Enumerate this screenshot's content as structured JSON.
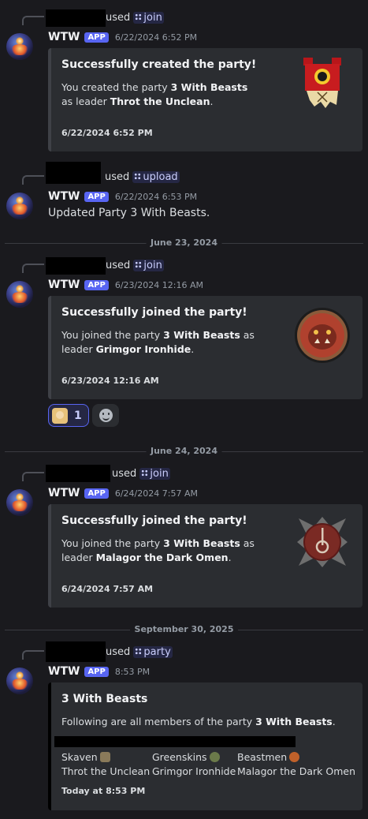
{
  "bot": {
    "name": "WTW",
    "badge": "APP"
  },
  "colors": {
    "accent": "#5865f2",
    "background": "#1a1a1e",
    "embed_bg": "#2b2d31"
  },
  "messages": [
    {
      "used_label": "used",
      "command": "join",
      "timestamp": "6/22/2024 6:52 PM",
      "embed": {
        "title": "Successfully created the party!",
        "desc_prefix": "You created the party ",
        "party": "3 With Beasts",
        "desc_mid": " as leader ",
        "leader": "Throt the Unclean",
        "desc_suffix": ".",
        "footer": "6/22/2024 6:52 PM",
        "thumbnail": "skaven-banner-icon"
      }
    },
    {
      "used_label": "used",
      "command": "upload",
      "timestamp": "6/22/2024 6:53 PM",
      "text": "Updated Party 3 With Beasts."
    },
    {
      "used_label": "used",
      "command": "join",
      "timestamp": "6/23/2024 12:16 AM",
      "embed": {
        "title": "Successfully joined the party!",
        "desc_prefix": "You joined the party ",
        "party": "3 With Beasts",
        "desc_mid": " as leader ",
        "leader": "Grimgor Ironhide",
        "desc_suffix": ".",
        "footer": "6/23/2024 12:16 AM",
        "thumbnail": "greenskin-portrait-icon"
      },
      "reactions": [
        {
          "emoji": "character-emoji",
          "count": "1"
        }
      ]
    },
    {
      "used_label": "used",
      "command": "join",
      "timestamp": "6/24/2024 7:57 AM",
      "embed": {
        "title": "Successfully joined the party!",
        "desc_prefix": "You joined the party ",
        "party": "3 With Beasts",
        "desc_mid": " as leader ",
        "leader": "Malagor the Dark Omen",
        "desc_suffix": ".",
        "footer": "6/24/2024 7:57 AM",
        "thumbnail": "beastmen-emblem-icon"
      }
    },
    {
      "used_label": "used",
      "command": "party",
      "timestamp": "8:53 PM",
      "embed": {
        "title": "3 With Beasts",
        "desc_prefix": "Following are all members of the party ",
        "party": "3 With Beasts",
        "desc_suffix": ".",
        "members": [
          {
            "faction": "Skaven",
            "leader": "Throt the Unclean",
            "icon": "skaven-faction-icon"
          },
          {
            "faction": "Greenskins",
            "leader": "Grimgor Ironhide",
            "icon": "greenskins-faction-icon"
          },
          {
            "faction": "Beastmen",
            "leader": "Malagor the Dark Omen",
            "icon": "beastmen-faction-icon"
          }
        ],
        "footer": "Today at 8:53 PM"
      }
    }
  ],
  "date_dividers": [
    "June 23, 2024",
    "June 24, 2024",
    "September 30, 2025"
  ]
}
